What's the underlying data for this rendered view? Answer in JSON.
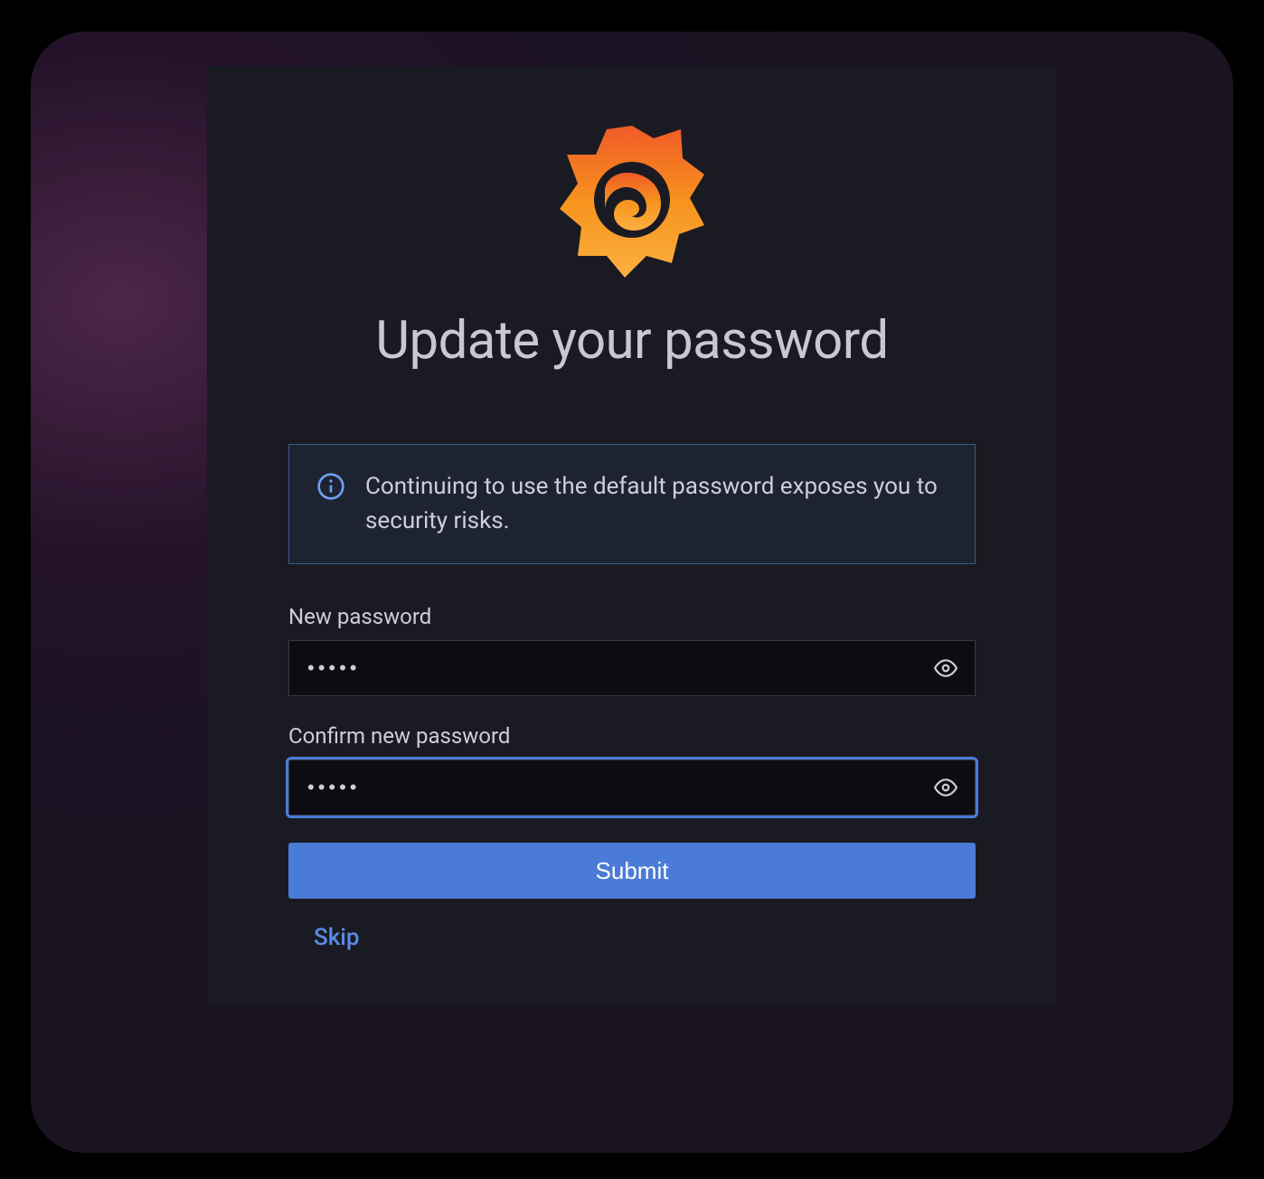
{
  "logo_name": "grafana-logo",
  "title": "Update your password",
  "info": {
    "icon": "info-icon",
    "text": "Continuing to use the default password exposes you to security risks."
  },
  "form": {
    "new_password": {
      "label": "New password",
      "value": "•••••"
    },
    "confirm_password": {
      "label": "Confirm new password",
      "value": "•••••"
    },
    "submit_label": "Submit",
    "skip_label": "Skip"
  },
  "colors": {
    "accent": "#4a7bd6",
    "card_bg": "#1a1a23",
    "input_bg": "#0d0c12"
  }
}
